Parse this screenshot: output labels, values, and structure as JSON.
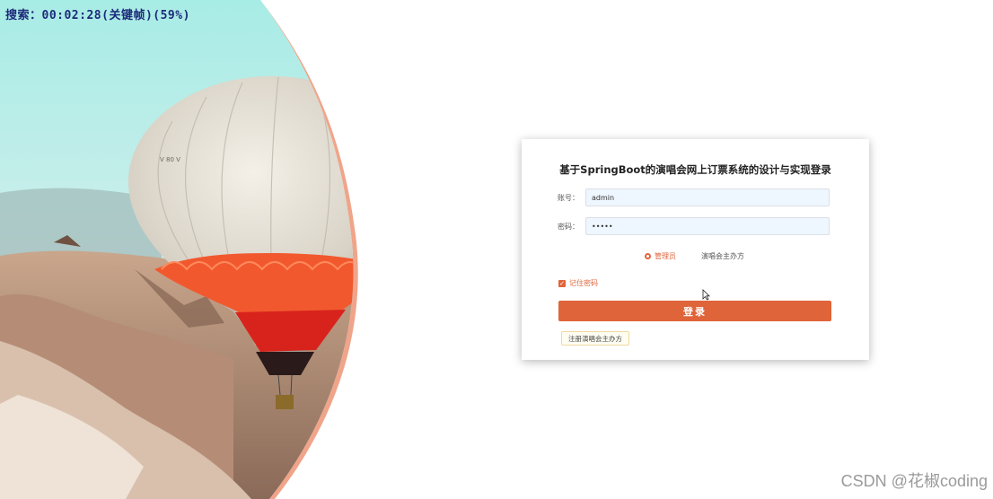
{
  "overlay": {
    "recording_status": "搜索：00:02:28(关键帧)(59%)"
  },
  "hero": {
    "balloon_marking": "V 80 V"
  },
  "login": {
    "title": "基于SpringBoot的演唱会网上订票系统的设计与实现登录",
    "username_label": "账号：",
    "username_value": "admin",
    "password_label": "密码：",
    "password_value": "•••••",
    "roles": [
      {
        "label": "管理员",
        "selected": true
      },
      {
        "label": "演唱会主办方",
        "selected": false
      }
    ],
    "remember_label": "记住密码",
    "remember_checked": true,
    "login_button": "登录",
    "register_button": "注册演唱会主办方"
  },
  "colors": {
    "accent": "#e0643a",
    "hero_sky": "#a8ece6",
    "balloon_orange": "#f2582e"
  },
  "watermark": "CSDN @花椒coding"
}
